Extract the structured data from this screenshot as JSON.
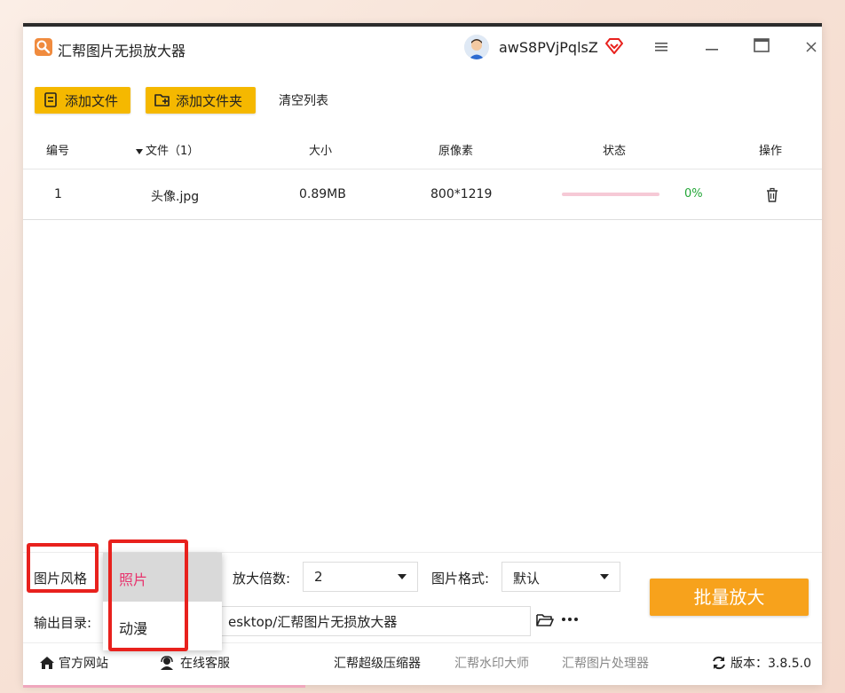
{
  "app": {
    "title": "汇帮图片无损放大器"
  },
  "user": {
    "name": "awS8PVjPqlsZ"
  },
  "toolbar": {
    "add_file": "添加文件",
    "add_folder": "添加文件夹",
    "clear_list": "清空列表"
  },
  "table": {
    "headers": {
      "id": "编号",
      "file": "文件（1）",
      "size": "大小",
      "pixels": "原像素",
      "status": "状态",
      "action": "操作"
    },
    "rows": [
      {
        "id": "1",
        "name": "头像.jpg",
        "size": "0.89MB",
        "pixels": "800*1219",
        "progress": 0,
        "percent": "0%"
      }
    ]
  },
  "settings": {
    "style_label": "图片风格",
    "scale_label": "放大倍数:",
    "scale_value": "2",
    "format_label": "图片格式:",
    "format_value": "默认",
    "output_label": "输出目录:",
    "output_path": "esktop/汇帮图片无损放大器",
    "batch_button": "批量放大"
  },
  "style_dropdown": {
    "options": [
      "照片",
      "动漫"
    ],
    "selected": "照片"
  },
  "footer": {
    "official_site": "官方网站",
    "online_service": "在线客服",
    "compressor": "汇帮超级压缩器",
    "watermark": "汇帮水印大师",
    "image_processor": "汇帮图片处理器",
    "version": "版本：3.8.5.0"
  },
  "colors": {
    "accent_yellow": "#f5b800",
    "batch_orange": "#f7a21c",
    "highlight_red": "#e8211d",
    "selected_pink": "#e8336d",
    "progress_green": "#22a636"
  }
}
